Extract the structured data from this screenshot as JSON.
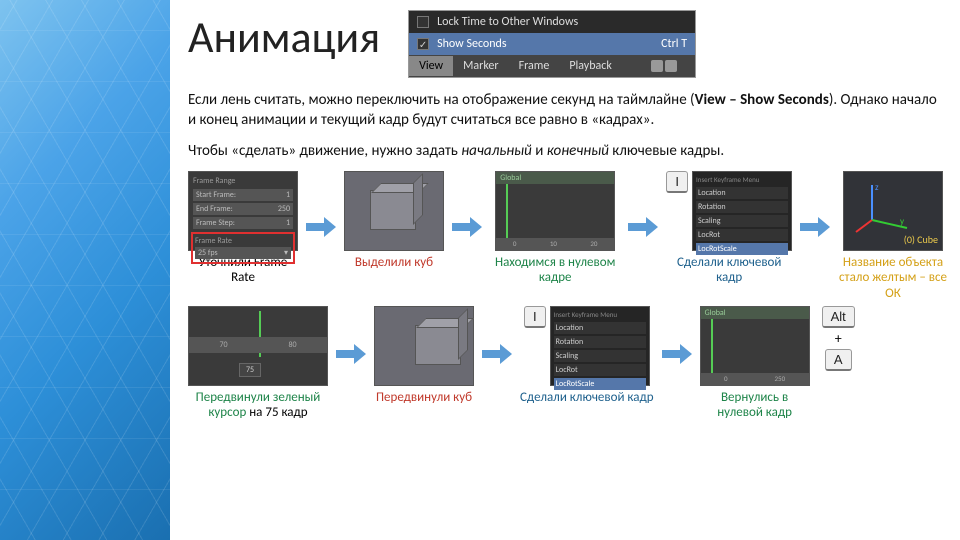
{
  "title": "Анимация",
  "menu": {
    "lock": "Lock Time to Other Windows",
    "show": "Show Seconds",
    "shortcut": "Ctrl T",
    "bar": [
      "View",
      "Marker",
      "Frame",
      "Playback"
    ]
  },
  "para1a": "Если лень считать, можно переключить на отображение секунд на таймлайне (",
  "para1b": "View – Show Seconds",
  "para1c": "). Однако начало и конец анимации и текущий кадр будут считаться все равно в «кадрах».",
  "para2a": "Чтобы «сделать» движение, нужно задать ",
  "para2b": "начальный",
  "para2c": " и ",
  "para2d": "конечный",
  "para2e": " ключевые кадры.",
  "props": {
    "header": "Frame Range",
    "rows": [
      [
        "Start Frame:",
        "1"
      ],
      [
        "End Frame:",
        "250"
      ],
      [
        "Frame Step:",
        "1"
      ]
    ],
    "rate_lbl": "Frame Rate",
    "rate_val": "25 fps"
  },
  "key_i": "I",
  "tl1": {
    "bar": "Global",
    "ticks": [
      "0",
      "10",
      "20"
    ]
  },
  "keymenu": {
    "hdr": "Insert Keyframe Menu",
    "items": [
      "Location",
      "Rotation",
      "Scaling",
      "LocRot"
    ],
    "hl": "LocRotScale"
  },
  "axes": {
    "label": "(0) Cube"
  },
  "caps1": [
    "Уточнили Frame Rate",
    "Выделили куб",
    "Находимся в нулевом кадре",
    "Сделали ключевой кадр",
    "Название объекта стало желтым – все ОК"
  ],
  "tl2": {
    "ticks": [
      "70",
      "80"
    ],
    "frame": "75"
  },
  "tl3": {
    "bar": "Global",
    "ticks": [
      "0",
      "250"
    ]
  },
  "caps2": [
    "Передвинули зеленый курсор на 75 кадр",
    "Передвинули куб",
    "Сделали ключевой кадр",
    "Вернулись в нулевой кадр"
  ],
  "alt": "Alt",
  "plus": "+",
  "A": "A"
}
